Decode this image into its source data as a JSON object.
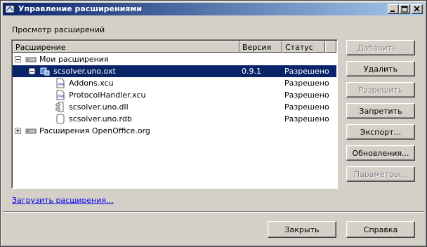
{
  "window": {
    "title": "Управление расширениями",
    "controls": {
      "minimize": "minimize-icon",
      "maximize": "maximize-icon",
      "close": "close-icon"
    }
  },
  "section_label": "Просмотр расширений",
  "tree": {
    "columns": {
      "extension": "Расширение",
      "version": "Версия",
      "status": "Статус"
    },
    "rows": [
      {
        "label": "Мои расширения",
        "version": "",
        "status": "",
        "icon": "drive-icon",
        "expander": "minus",
        "level": 0,
        "selected": false
      },
      {
        "label": "scsolver.uno.oxt",
        "version": "0.9.1",
        "status": "Разрешено",
        "icon": "package-icon",
        "expander": "minus",
        "level": 1,
        "selected": true
      },
      {
        "label": "Addons.xcu",
        "version": "",
        "status": "Разрешено",
        "icon": "xml-file-icon",
        "level": 2,
        "selected": false
      },
      {
        "label": "ProtocolHandler.xcu",
        "version": "",
        "status": "Разрешено",
        "icon": "xml-file-icon",
        "level": 2,
        "selected": false
      },
      {
        "label": "scsolver.uno.dll",
        "version": "",
        "status": "Разрешено",
        "icon": "component-icon",
        "level": 2,
        "selected": false
      },
      {
        "label": "scsolver.uno.rdb",
        "version": "",
        "status": "Разрешено",
        "icon": "database-icon",
        "level": 2,
        "selected": false
      },
      {
        "label": "Расширения OpenOffice.org",
        "version": "",
        "status": "",
        "icon": "drive-icon",
        "expander": "plus",
        "level": 0,
        "selected": false
      }
    ]
  },
  "buttons": {
    "add": "Добавить...",
    "remove": "Удалить",
    "enable": "Разрешить",
    "disable": "Запретить",
    "export": "Экспорт...",
    "updates": "Обновления...",
    "options": "Параметры..."
  },
  "link": "Загрузить расширения...",
  "footer": {
    "close": "Закрыть",
    "help": "Справка"
  },
  "colors": {
    "selection": "#0a246a",
    "title_start": "#0a246a",
    "title_end": "#a6caf0",
    "face": "#d4d0c8",
    "link": "#0000ee"
  }
}
